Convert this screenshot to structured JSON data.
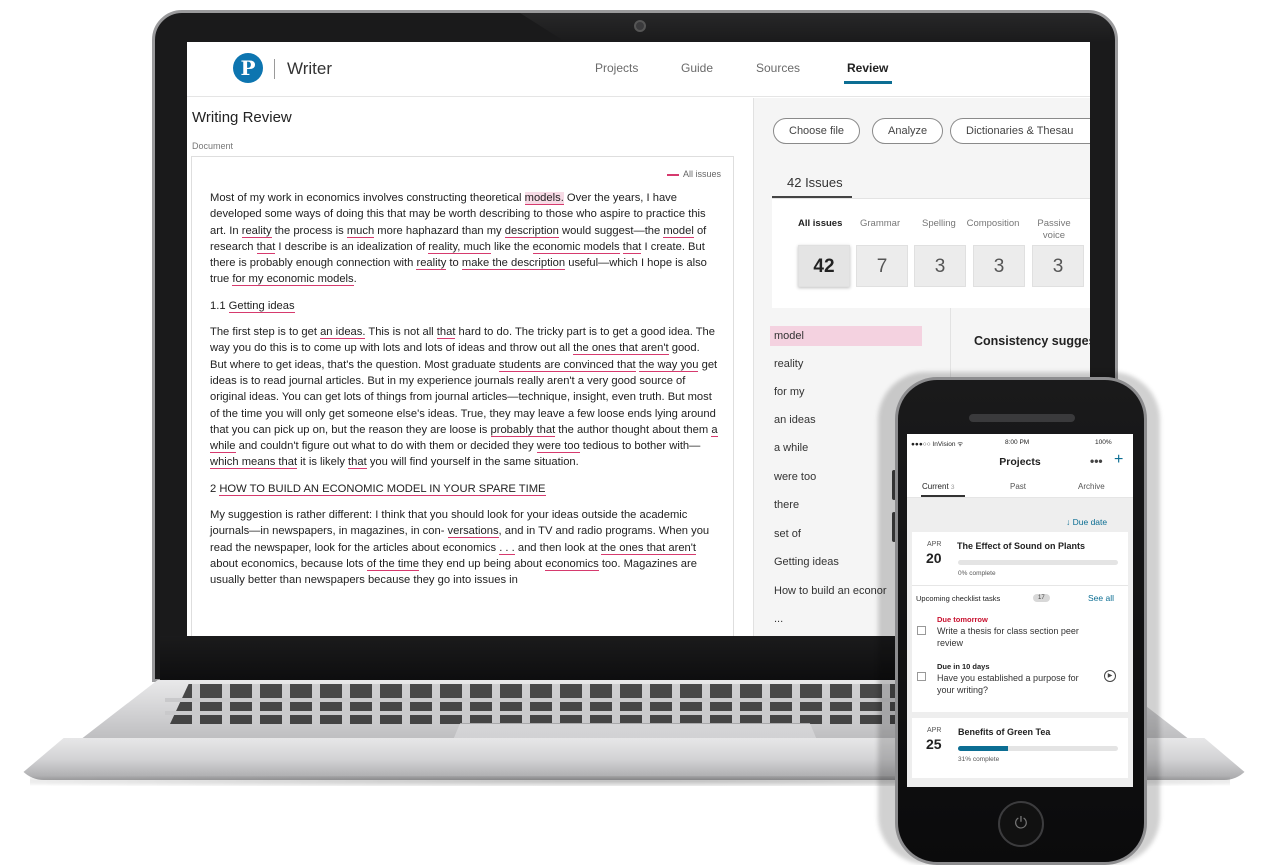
{
  "app": {
    "name": "Writer",
    "logo_letter": "P",
    "nav": [
      "Projects",
      "Guide",
      "Sources",
      "Review"
    ],
    "active_nav": "Review"
  },
  "review": {
    "title": "Writing Review",
    "doc_label": "Document",
    "all_issues_tag": "All issues",
    "paragraphs": {
      "p1": [
        {
          "t": "Most of my work in economics involves constructing theoretical "
        },
        {
          "t": "models.",
          "s": "hl"
        },
        {
          "t": " Over the years, I have developed some ways of doing this that may be worth describing to those who aspire to practice this art. In "
        },
        {
          "t": "reality",
          "s": "u"
        },
        {
          "t": " the process is "
        },
        {
          "t": "much",
          "s": "u"
        },
        {
          "t": " more haphazard than my "
        },
        {
          "t": "description",
          "s": "u"
        },
        {
          "t": " would suggest—the "
        },
        {
          "t": "model",
          "s": "u"
        },
        {
          "t": " of research "
        },
        {
          "t": "that",
          "s": "u"
        },
        {
          "t": " I describe is an idealization of "
        },
        {
          "t": "reality, much",
          "s": "u"
        },
        {
          "t": " like the "
        },
        {
          "t": "economic models",
          "s": "u"
        },
        {
          "t": " "
        },
        {
          "t": "that",
          "s": "u"
        },
        {
          "t": " I create. But there is probably enough connection with "
        },
        {
          "t": "reality",
          "s": "u"
        },
        {
          "t": " to "
        },
        {
          "t": "make the description",
          "s": "u"
        },
        {
          "t": " useful—which I hope is also true "
        },
        {
          "t": "for  my economic models",
          "s": "u"
        },
        {
          "t": "."
        }
      ],
      "h1": [
        {
          "t": "1.1   "
        },
        {
          "t": "Getting ideas",
          "s": "u"
        }
      ],
      "p2": [
        {
          "t": "The first step is to get "
        },
        {
          "t": "an ideas.",
          "s": "u"
        },
        {
          "t": " This is not all "
        },
        {
          "t": "that",
          "s": "u"
        },
        {
          "t": " hard to do. The tricky part is to get a good idea. The way you do this is to come up with lots and lots of ideas and throw out all "
        },
        {
          "t": "the ones that aren't",
          "s": "u"
        },
        {
          "t": " good."
        }
      ],
      "p3": [
        {
          "t": "But where to get ideas, that's the question. Most graduate "
        },
        {
          "t": "students are convinced that",
          "s": "u"
        },
        {
          "t": " "
        },
        {
          "t": "the way you",
          "s": "u"
        },
        {
          "t": " get ideas is to read journal articles. But in my experience journals really aren't a very good source of original ideas. You can get lots of things from journal articles—technique, insight, even truth. But most of the time you will only get someone else's ideas. True,  they  may leave a few loose ends lying around that you can pick up on, but the reason they are loose is "
        },
        {
          "t": "probably that",
          "s": "u"
        },
        {
          "t": " the author thought about them "
        },
        {
          "t": "a   while",
          "s": "u"
        },
        {
          "t": " and couldn't figure out what to do with them or decided they "
        },
        {
          "t": "were  too",
          "s": "u"
        },
        {
          "t": " tedious to bother with—"
        },
        {
          "t": "which means that",
          "s": "u"
        },
        {
          "t": " it is likely "
        },
        {
          "t": "that",
          "s": "u"
        },
        {
          "t": " you will find yourself in the same situation."
        }
      ],
      "h2": [
        {
          "t": "2      "
        },
        {
          "t": "HOW TO BUILD AN ECONOMIC MODEL IN YOUR SPARE TIME",
          "s": "u"
        }
      ],
      "p4": [
        {
          "t": "My suggestion is rather different: I think that you should look for your ideas outside the academic journals—in newspapers, in magazines, in con- "
        },
        {
          "t": "versations",
          "s": "u"
        },
        {
          "t": ", and in TV and radio programs. When you read the newspaper, look for the articles about economics "
        },
        {
          "t": ". . .",
          "s": "u"
        },
        {
          "t": " and then look at "
        },
        {
          "t": "the ones that aren't",
          "s": "u"
        },
        {
          "t": " about economics, because lots "
        },
        {
          "t": "of the time",
          "s": "u"
        },
        {
          "t": " they end up being about "
        },
        {
          "t": "economics",
          "s": "u"
        },
        {
          "t": " too. Magazines are usually better than newspapers because they go into issues in"
        }
      ]
    }
  },
  "tools": {
    "buttons": [
      "Choose file",
      "Analyze",
      "Dictionaries & Thesau"
    ]
  },
  "issues": {
    "tab_label": "42 Issues",
    "categories": [
      {
        "label": "All issues",
        "count": "42"
      },
      {
        "label": "Grammar",
        "count": "7"
      },
      {
        "label": "Spelling",
        "count": "3"
      },
      {
        "label": "Composition",
        "count": "3"
      },
      {
        "label": "Passive voice",
        "count": "3"
      }
    ],
    "words": [
      "model",
      "reality",
      "for  my",
      "an ideas",
      "a while",
      "were too",
      "there",
      "set of",
      "Getting ideas",
      "How to build an econor",
      "..."
    ],
    "active_word": "model",
    "suggestion_title": "Consistency sugges"
  },
  "phone": {
    "status": {
      "carrier": "●●●○○ InVision ᯤ",
      "time": "8:00 PM",
      "battery": "100%"
    },
    "title": "Projects",
    "tabs": [
      {
        "label": "Current",
        "count": "3"
      },
      {
        "label": "Past"
      },
      {
        "label": "Archive"
      }
    ],
    "sort_label": "↓ Due date",
    "project1": {
      "month": "APR",
      "day": "20",
      "title": "The Effect of Sound on Plants",
      "progress": 0,
      "pct_label": "0% complete"
    },
    "checklist": {
      "label": "Upcoming checklist tasks",
      "count": "17",
      "see_all": "See all"
    },
    "tasks": [
      {
        "due": "Due tomorrow",
        "text": "Write a thesis for class section peer review",
        "due_color": "#c8102e"
      },
      {
        "due": "Due in 10 days",
        "text": "Have you established a purpose for your writing?",
        "due_color": "#222222"
      }
    ],
    "project2": {
      "month": "APR",
      "day": "25",
      "title": "Benefits of Green Tea",
      "progress": 0.31,
      "pct_label": "31% complete"
    }
  },
  "colors": {
    "accent": "#0c6e93",
    "issue_underline": "#d63a6e",
    "issue_highlight": "#f7dbe6",
    "logo": "#0d75b0"
  }
}
